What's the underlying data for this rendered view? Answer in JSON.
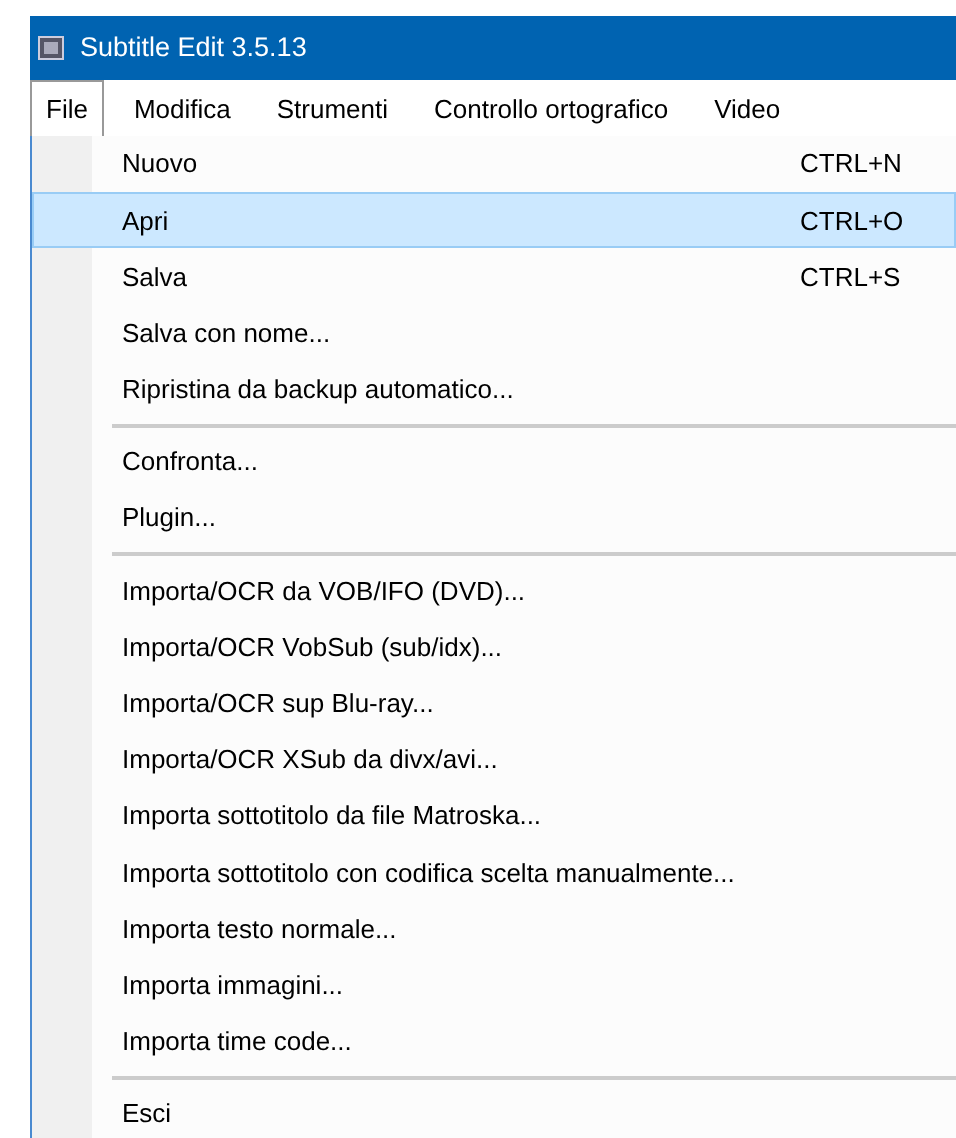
{
  "window": {
    "title": "Subtitle Edit 3.5.13"
  },
  "menubar": [
    {
      "label": "File",
      "selected": true
    },
    {
      "label": "Modifica",
      "selected": false
    },
    {
      "label": "Strumenti",
      "selected": false
    },
    {
      "label": "Controllo ortografico",
      "selected": false
    },
    {
      "label": "Video",
      "selected": false
    }
  ],
  "menu": [
    {
      "kind": "item",
      "label": "Nuovo",
      "shortcut": "CTRL+N",
      "selected": false
    },
    {
      "kind": "item",
      "label": "Apri",
      "shortcut": "CTRL+O",
      "selected": true
    },
    {
      "kind": "item",
      "label": "Salva",
      "shortcut": "CTRL+S",
      "selected": false
    },
    {
      "kind": "item",
      "label": "Salva con nome...",
      "selected": false
    },
    {
      "kind": "item",
      "label": "Ripristina da backup automatico...",
      "selected": false
    },
    {
      "kind": "separator"
    },
    {
      "kind": "item",
      "label": "Confronta...",
      "selected": false
    },
    {
      "kind": "item",
      "label": "Plugin...",
      "selected": false
    },
    {
      "kind": "separator"
    },
    {
      "kind": "item",
      "label": "Importa/OCR da VOB/IFO (DVD)...",
      "selected": false
    },
    {
      "kind": "item",
      "label": "Importa/OCR VobSub (sub/idx)...",
      "selected": false
    },
    {
      "kind": "item",
      "label": "Importa/OCR sup Blu-ray...",
      "selected": false
    },
    {
      "kind": "item",
      "label": "Importa/OCR XSub da divx/avi...",
      "selected": false
    },
    {
      "kind": "item",
      "label": "Importa sottotitolo da file Matroska...",
      "selected": false
    },
    {
      "kind": "item",
      "label": "Importa sottotitolo con codifica scelta manualmente...",
      "selected": false
    },
    {
      "kind": "item",
      "label": "Importa testo normale...",
      "selected": false
    },
    {
      "kind": "item",
      "label": "Importa immagini...",
      "selected": false
    },
    {
      "kind": "item",
      "label": "Importa time code...",
      "selected": false
    },
    {
      "kind": "separator"
    },
    {
      "kind": "item",
      "label": "Esci",
      "selected": false
    }
  ]
}
